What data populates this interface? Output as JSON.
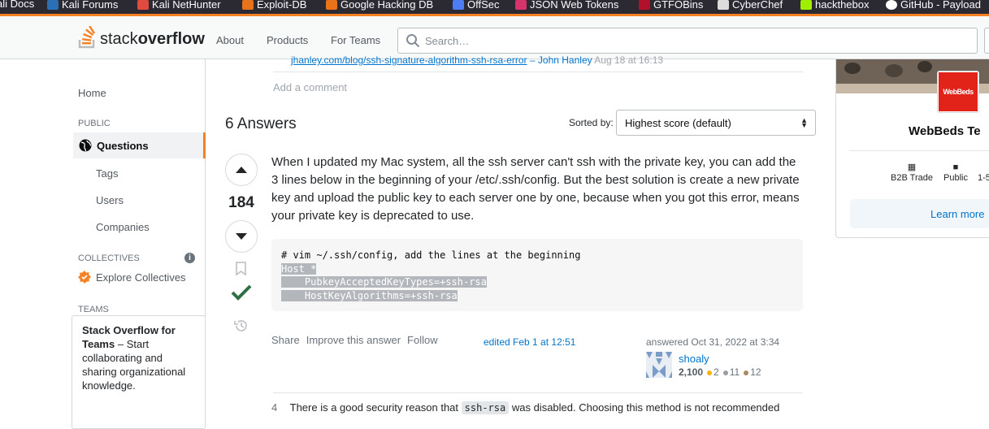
{
  "bookmarks": [
    {
      "label": "ali Docs",
      "color": "#2c6fb5"
    },
    {
      "label": "Kali Forums",
      "color": "#2c6fb5"
    },
    {
      "label": "Kali NetHunter",
      "color": "#e04a3f"
    },
    {
      "label": "Exploit-DB",
      "color": "#e8731b"
    },
    {
      "label": "Google Hacking DB",
      "color": "#e8731b"
    },
    {
      "label": "OffSec",
      "color": "#4d7df5"
    },
    {
      "label": "JSON Web Tokens",
      "color": "#d6336c"
    },
    {
      "label": "GTFOBins",
      "color": "#b3102b"
    },
    {
      "label": "CyberChef",
      "color": "#dcdcdc"
    },
    {
      "label": "hackthebox",
      "color": "#9fef00"
    },
    {
      "label": "GitHub - Payload",
      "color": "#ffffff"
    }
  ],
  "header": {
    "logo_light": "stack",
    "logo_bold": "overflow",
    "nav": [
      "About",
      "Products",
      "For Teams"
    ],
    "search_placeholder": "Search…"
  },
  "leftnav": {
    "home": "Home",
    "public": "PUBLIC",
    "questions": "Questions",
    "tags": "Tags",
    "users": "Users",
    "companies": "Companies",
    "collectives": "COLLECTIVES",
    "explore": "Explore Collectives",
    "teams": "TEAMS",
    "teams_title": "Stack Overflow for Teams",
    "teams_text": "– Start collaborating and sharing organizational knowledge."
  },
  "question": {
    "prev_link": "jhanley.com/blog/ssh-signature-algorithm-ssh-rsa-error",
    "prev_author": "– John Hanley",
    "prev_date": "Aug 18 at 16:13",
    "add_comment": "Add a comment"
  },
  "answers": {
    "title": "6 Answers",
    "sorted_label": "Sorted by:",
    "sort_value": "Highest score (default)"
  },
  "answer": {
    "score": "184",
    "text": "When I updated my Mac system, all the ssh server can't ssh with the private key, you can add the 3 lines below in the beginning of your /etc/.ssh/config. But the best solution is create a new private key and upload the public key to each server one by one, because when you got this error, means your private key is deprecated to use.",
    "code": [
      "# vim ~/.ssh/config, add the lines at the beginning",
      "Host *",
      "    PubkeyAcceptedKeyTypes=+ssh-rsa",
      "    HostKeyAlgorithms=+ssh-rsa"
    ],
    "menu": [
      "Share",
      "Improve this answer",
      "Follow"
    ],
    "edited": "edited Feb 1 at 12:51",
    "answered": "answered Oct 31, 2022 at 3:34",
    "user": "shoaly",
    "rep": "2,100",
    "gold": "2",
    "silver": "11",
    "bronze": "12"
  },
  "comment": {
    "score": "4",
    "before": "There is a good security reason that",
    "code": "ssh-rsa",
    "after": "was disabled. Choosing this method is not recommended"
  },
  "sidebar": {
    "logo_text": "WebBeds",
    "company": "WebBeds Te",
    "meta": [
      "B2B Trade",
      "Public",
      "1-5"
    ],
    "learn_more": "Learn more"
  }
}
